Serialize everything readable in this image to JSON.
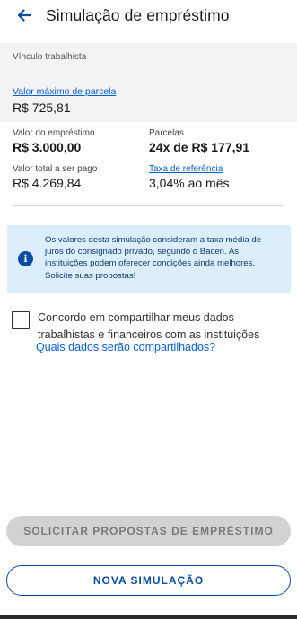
{
  "appbar": {
    "title": "Simulação de empréstimo",
    "back_icon": "arrow-left-icon"
  },
  "bond": {
    "label": "Vínculo trabalhista"
  },
  "max_installment": {
    "label": "Valor máximo de parcela",
    "value": "R$ 725,81"
  },
  "summary": {
    "loan_amount": {
      "label": "Valor do empréstimo",
      "value": "R$ 3.000,00"
    },
    "installments": {
      "label": "Parcelas",
      "value": "24x de R$ 177,91"
    },
    "total_to_pay": {
      "label": "Valor total a ser pago",
      "value": "R$ 4.269,84"
    },
    "reference_rate": {
      "label": "Taxa de referência",
      "value": "3,04% ao mês"
    }
  },
  "info": {
    "icon": "info-icon",
    "text": "Os valores desta simulação consideram a taxa média de juros do consignado privado, segundo o Bacen. As instituições podem oferecer condições ainda melhores. Solicite suas propostas!"
  },
  "consent": {
    "text": "Concordo em compartilhar meus dados trabalhistas e financeiros com as instituições",
    "link": "Quais dados serão compartilhados?",
    "checked": false
  },
  "buttons": {
    "request": "SOLICITAR PROPOSTAS DE EMPRÉSTIMO",
    "new_simulation": "NOVA SIMULAÇÃO"
  },
  "colors": {
    "primary": "#0b4da3",
    "link": "#0a60c8",
    "info_bg": "#dceefb",
    "disabled_bg": "#d2d2d2"
  }
}
